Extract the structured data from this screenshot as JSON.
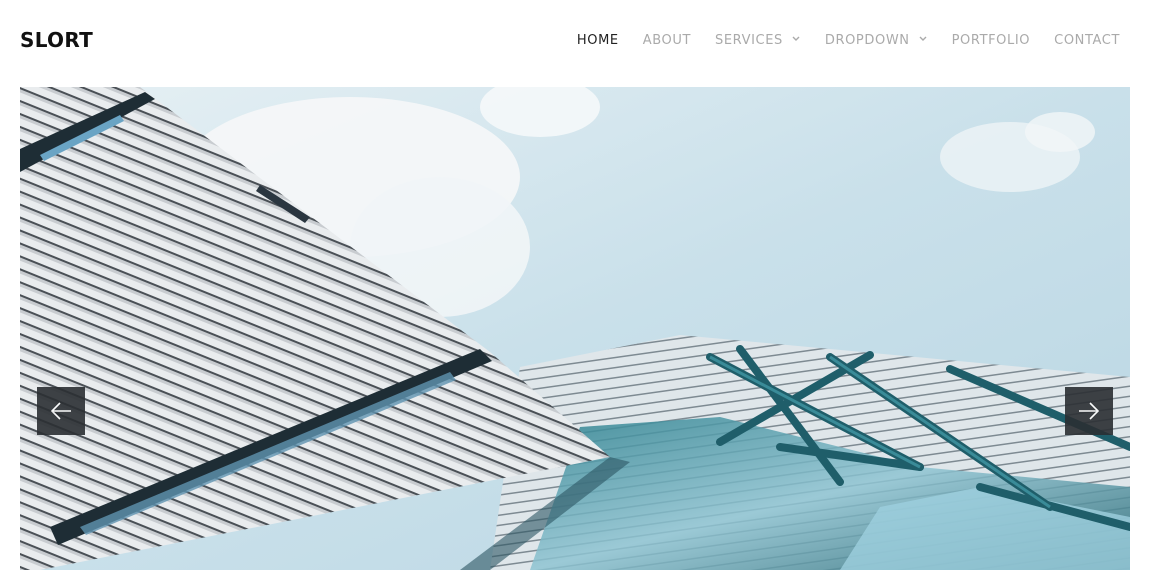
{
  "brand": {
    "logo_text": "SLORT"
  },
  "nav": {
    "items": [
      {
        "label": "HOME",
        "active": true
      },
      {
        "label": "ABOUT",
        "active": false
      },
      {
        "label": "SERVICES",
        "active": false,
        "has_dropdown": true
      },
      {
        "label": "DROPDOWN",
        "active": false,
        "has_dropdown": true
      },
      {
        "label": "PORTFOLIO",
        "active": false
      },
      {
        "label": "CONTACT",
        "active": false
      }
    ]
  },
  "slider": {
    "image_subject": "modern glass building facade against cloudy sky",
    "prev_icon": "arrow-left-icon",
    "next_icon": "arrow-right-icon"
  },
  "colors": {
    "active_nav": "#222222",
    "inactive_nav": "#aaaaaa",
    "arrow_button_bg": "#2b2f33",
    "sky": "#cfe4ee",
    "glass_teal": "#1f6f7a"
  }
}
